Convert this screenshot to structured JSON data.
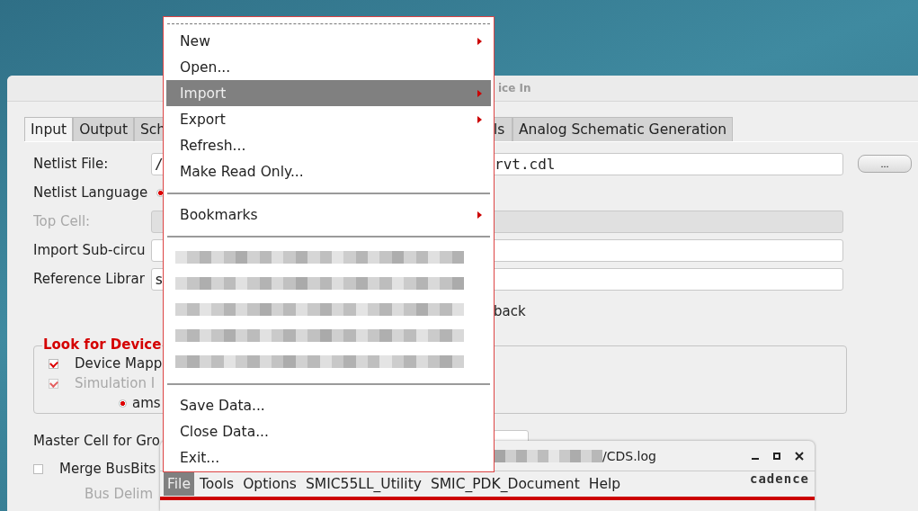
{
  "dialog": {
    "title": "ice In",
    "tabs": [
      {
        "label": "Input",
        "selected": true
      },
      {
        "label": "Output",
        "selected": false
      },
      {
        "label": "Sch",
        "selected": false
      },
      {
        "label": "ls",
        "selected": false
      },
      {
        "label": "Analog Schematic Generation",
        "selected": false
      }
    ],
    "browse_button": "...",
    "rows": [
      {
        "kind": "field",
        "label": "Netlist File:",
        "value_left": "/",
        "value_right": "rvt.cdl",
        "disabled": false
      },
      {
        "kind": "radio",
        "label": "Netlist Language",
        "selected": true
      },
      {
        "kind": "field",
        "label": "Top Cell:",
        "disabled": true
      },
      {
        "kind": "field",
        "label": "Import Sub-circu",
        "disabled": false
      },
      {
        "kind": "field",
        "label": "Reference Librar",
        "value_left": "s",
        "disabled": false
      },
      {
        "kind": "text",
        "text_right": "back"
      }
    ],
    "group": {
      "legend": "Look for Device ",
      "items": [
        {
          "kind": "checkbox",
          "label": "Device Mapp",
          "checked": true,
          "disabled": false
        },
        {
          "kind": "checkbox",
          "label": "Simulation I",
          "checked": true,
          "disabled": true
        },
        {
          "kind": "radio",
          "label": "ams",
          "selected": true
        }
      ]
    },
    "master_cell_label": "Master Cell for Gro",
    "merge_busbits": {
      "label": "Merge BusBits",
      "checked": false
    },
    "bus_delim": {
      "label": "Bus Delim",
      "disabled": true
    }
  },
  "file_menu": {
    "items": [
      {
        "kind": "item",
        "label": "New",
        "submenu": true,
        "selected": false
      },
      {
        "kind": "item",
        "label": "Open...",
        "submenu": false,
        "selected": false
      },
      {
        "kind": "item",
        "label": "Import",
        "submenu": true,
        "selected": true
      },
      {
        "kind": "item",
        "label": "Export",
        "submenu": true,
        "selected": false
      },
      {
        "kind": "item",
        "label": "Refresh...",
        "submenu": false,
        "selected": false
      },
      {
        "kind": "item",
        "label": "Make Read Only...",
        "submenu": false,
        "selected": false
      },
      {
        "kind": "separator"
      },
      {
        "kind": "item",
        "label": "Bookmarks",
        "submenu": true,
        "selected": false
      },
      {
        "kind": "separator"
      },
      {
        "kind": "redacted"
      },
      {
        "kind": "redacted"
      },
      {
        "kind": "redacted"
      },
      {
        "kind": "redacted"
      },
      {
        "kind": "redacted"
      },
      {
        "kind": "separator"
      },
      {
        "kind": "item",
        "label": "Save Data...",
        "submenu": false,
        "selected": false
      },
      {
        "kind": "item",
        "label": "Close Data...",
        "submenu": false,
        "selected": false
      },
      {
        "kind": "item",
        "label": "Exit...",
        "submenu": false,
        "selected": false
      }
    ]
  },
  "ciw": {
    "title": "/CDS.log",
    "title_redacted": true,
    "menus": [
      {
        "label": "File",
        "selected": true
      },
      {
        "label": "Tools",
        "selected": false
      },
      {
        "label": "Options",
        "selected": false
      },
      {
        "label": "SMIC55LL_Utility",
        "selected": false
      },
      {
        "label": "SMIC_PDK_Document",
        "selected": false
      },
      {
        "label": "Help",
        "selected": false
      }
    ],
    "logo": "cadence"
  }
}
